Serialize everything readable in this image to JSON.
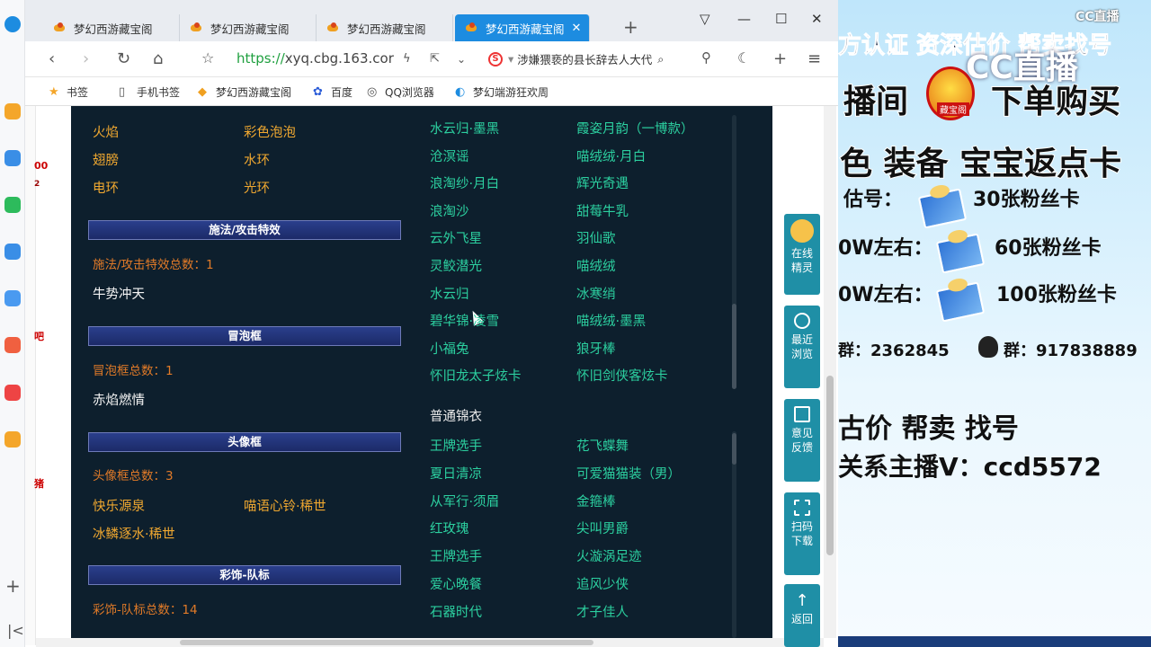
{
  "tabs": [
    {
      "label": "梦幻西游藏宝阁"
    },
    {
      "label": "梦幻西游藏宝阁"
    },
    {
      "label": "梦幻西游藏宝阁"
    },
    {
      "label": "梦幻西游藏宝阁",
      "active": true
    }
  ],
  "address": {
    "scheme": "https://",
    "host": "xyq.cbg.163.cor"
  },
  "search": {
    "text": "涉嫌猥亵的县长辞去人大代"
  },
  "bookmarks": [
    "书签",
    "手机书签",
    "梦幻西游藏宝阁",
    "百度",
    "QQ浏览器",
    "梦幻端游狂欢周"
  ],
  "edge_labels": [
    "00",
    "2",
    "吧",
    "猪"
  ],
  "left": {
    "top_row_items": [
      "火焰",
      "彩色泡泡",
      "翅膀",
      "水环",
      "电环",
      "光环"
    ],
    "sections": [
      {
        "title": "施法/攻击特效",
        "count_label": "施法/攻击特效总数：1",
        "items": [
          "牛势冲天"
        ]
      },
      {
        "title": "冒泡框",
        "count_label": "冒泡框总数：1",
        "items": [
          "赤焰燃情"
        ]
      },
      {
        "title": "头像框",
        "count_label": "头像框总数：3",
        "items": [
          "快乐源泉",
          "喵语心铃·稀世",
          "冰鳞逐水·稀世"
        ]
      },
      {
        "title": "彩饰-队标",
        "count_label": "彩饰-队标总数：14",
        "items": []
      }
    ]
  },
  "right": {
    "rare_items": [
      "水云归·墨黑",
      "霞姿月韵（一博款）",
      "沧溟谣",
      "喵绒绒·月白",
      "浪淘纱·月白",
      "辉光奇遇",
      "浪淘沙",
      "甜莓牛乳",
      "云外飞星",
      "羽仙歌",
      "灵鲛潜光",
      "喵绒绒",
      "水云归",
      "冰寒绡",
      "碧华锦·凌雪",
      "喵绒绒·墨黑",
      "小福兔",
      "狼牙棒",
      "怀旧龙太子炫卡",
      "怀旧剑侠客炫卡"
    ],
    "common_heading": "普通锦衣",
    "common_items": [
      "王牌选手",
      "花飞蝶舞",
      "夏日清凉",
      "可爱猫猫装（男）",
      "从军行·须眉",
      "金箍棒",
      "红玫瑰",
      "尖叫男爵",
      "王牌选手",
      "火漩涡足迹",
      "爱心晚餐",
      "追风少侠",
      "石器时代",
      "才子佳人"
    ]
  },
  "sidepanel": [
    {
      "label": "在线精灵",
      "icon": "avatar-icon"
    },
    {
      "label": "最近浏览",
      "icon": "clock-icon"
    },
    {
      "label": "意见反馈",
      "icon": "edit-icon"
    },
    {
      "label": "扫码下载",
      "icon": "scan-icon"
    },
    {
      "label": "返回",
      "icon": "arrow-up-icon"
    }
  ],
  "stream": {
    "brand_small": "CC直播",
    "brand_big": "CC直播",
    "line1": "方认证 资深估价 帮卖找号",
    "line2_left": "播间",
    "line2_right": "下单购买",
    "badge": "藏宝阁",
    "line3": "色 装备 宝宝返点卡",
    "tier1_label": "估号：",
    "tier1_reward": "30张粉丝卡",
    "tier2_label": "0W左右：",
    "tier2_reward": "60张粉丝卡",
    "tier3_label": "0W左右：",
    "tier3_reward": "100张粉丝卡",
    "group1": "群：2362845",
    "group2": "群：917838889",
    "line4": "古价 帮卖 找号",
    "line5": "关系主播V：ccd5572"
  }
}
